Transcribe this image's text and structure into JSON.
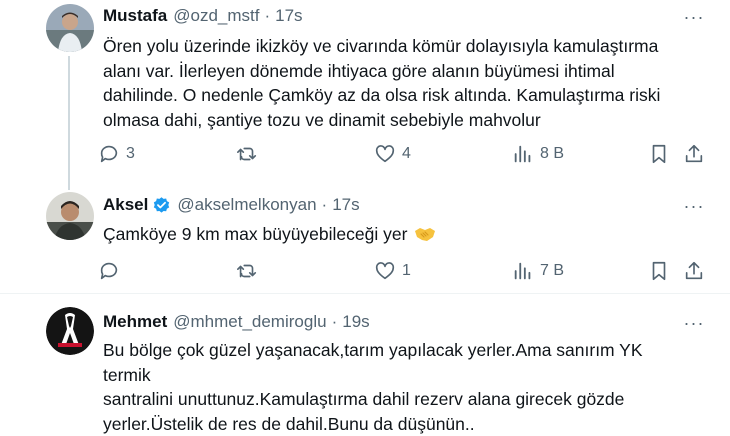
{
  "tweets": [
    {
      "name": "Mustafa",
      "handle": "@ozd_mstf",
      "sep": "·",
      "time": "17s",
      "more": "···",
      "lines": [
        "Ören yolu üzerinde ikizköy ve civarında kömür dolayısıyla kamulaştırma",
        "alanı var. İlerleyen dönemde ihtiyaca göre alanın büyümesi ihtimal",
        "dahilinde. O nedenle Çamköy az da olsa risk altında. Kamulaştırma riski",
        "olmasa dahi, şantiye tozu ve dinamit sebebiyle mahvolur"
      ],
      "replies": "3",
      "retweets": "",
      "likes": "4",
      "views": "8 B"
    },
    {
      "name": "Aksel",
      "handle": "@akselmelkonyan",
      "sep": "·",
      "time": "17s",
      "more": "···",
      "verified": true,
      "lines": [
        "Çamköye 9 km max büyüyebileceği yer"
      ],
      "emoji": "handshake",
      "replies": "",
      "retweets": "",
      "likes": "1",
      "views": "7 B"
    },
    {
      "name": "Mehmet",
      "handle": "@mhmet_demiroglu",
      "sep": "·",
      "time": "19s",
      "more": "···",
      "lines": [
        "Bu bölge çok güzel yaşanacak,tarım yapılacak yerler.Ama sanırım YK termik",
        "santralini unuttunuz.Kamulaştırma dahil rezerv alana girecek gözde",
        "yerler.Üstelik de res de dahil.Bunu da düşünün.."
      ]
    }
  ],
  "colors": {
    "text": "#0f1419",
    "secondary": "#536471",
    "verified": "#1d9bf0",
    "separator": "#eff3f4",
    "thread_line": "#cfd9de"
  },
  "icons": [
    "reply-icon",
    "retweet-icon",
    "like-icon",
    "views-icon",
    "bookmark-icon",
    "share-icon",
    "verified-badge-icon",
    "more-icon"
  ]
}
